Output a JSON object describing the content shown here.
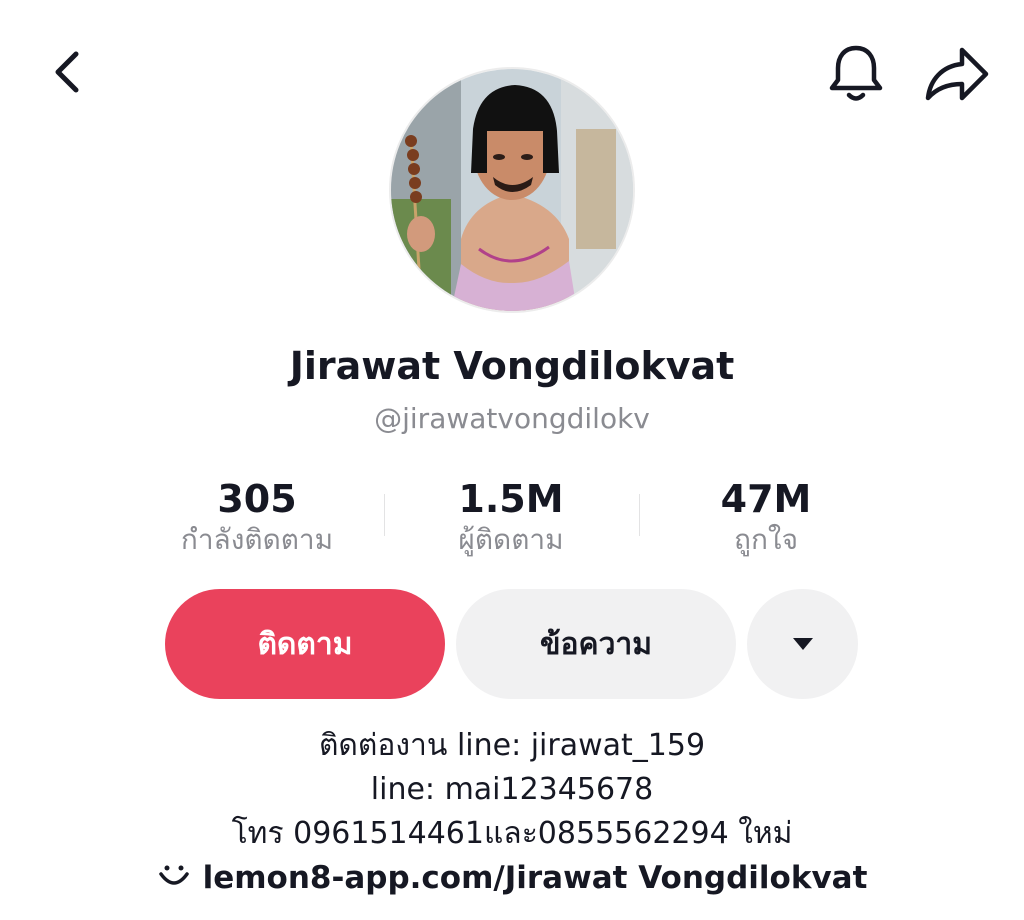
{
  "profile": {
    "name": "Jirawat Vongdilokvat",
    "handle": "@jirawatvongdilokv"
  },
  "stats": [
    {
      "value": "305",
      "label": "กำลังติดตาม"
    },
    {
      "value": "1.5M",
      "label": "ผู้ติดตาม"
    },
    {
      "value": "47M",
      "label": "ถูกใจ"
    }
  ],
  "actions": {
    "follow_label": "ติดตาม",
    "message_label": "ข้อความ",
    "more_icon": "triangle-down-icon"
  },
  "bio": {
    "lines": [
      "ติดต่องาน line: jirawat_159",
      "line: mai12345678",
      "โทร 0961514461และ0855562294 ใหม่"
    ],
    "link": "lemon8-app.com/Jirawat Vongdilokvat",
    "link_icon": "lemon8-smile-icon"
  },
  "icons": {
    "back": "chevron-left-icon",
    "notifications": "bell-icon",
    "share": "share-arrow-icon"
  },
  "colors": {
    "accent": "#ea425c",
    "secondary_button": "#f1f1f2",
    "muted_text": "#8a8b91"
  }
}
